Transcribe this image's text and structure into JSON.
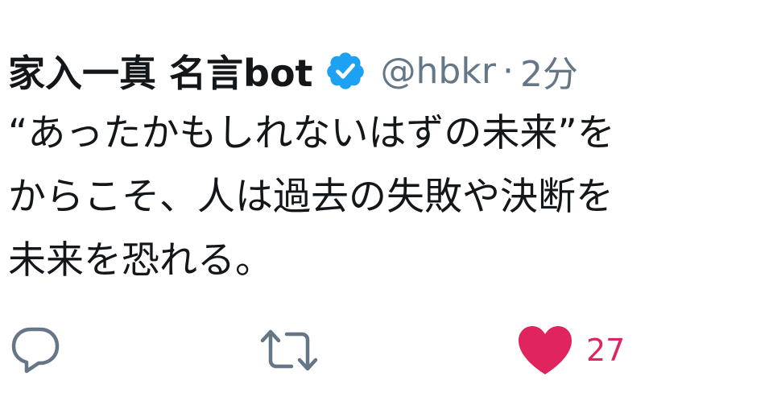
{
  "tweet": {
    "display_name": "家入一真 名言bot",
    "handle": "@hbkr",
    "separator": "·",
    "time": "2分",
    "lines": [
      "“あったかもしれないはずの未来”を",
      "からこそ、人は過去の失敗や決断を",
      "未来を恐れる。"
    ]
  },
  "actions": {
    "reply_icon": "reply-icon",
    "retweet_icon": "retweet-icon",
    "like_icon": "heart-icon",
    "like_count": "27"
  },
  "colors": {
    "verified": "#1da1f2",
    "muted": "#657786",
    "icon": "#657786",
    "like": "#e0245e",
    "text": "#14171a"
  }
}
